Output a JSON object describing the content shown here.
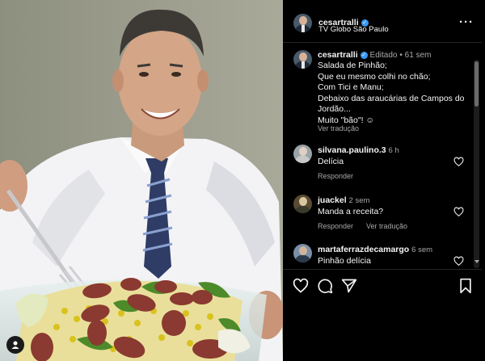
{
  "post": {
    "author": "cesartralli",
    "location": "TV Globo São Paulo",
    "more_icon": "more-horizontal-icon",
    "caption": {
      "author": "cesartralli",
      "edited": "Editado",
      "time": "61 sem",
      "lines": [
        "Salada de Pinhão;",
        "Que eu mesmo colhi no chão;",
        "Com Tici e Manu;",
        "Debaixo das araucárias de Campos do",
        "Jordão...",
        "Muito \"bão\"! ☺"
      ],
      "see_translation": "Ver tradução"
    },
    "comments": [
      {
        "user": "silvana.paulino.3",
        "time": "6 h",
        "text": "Delícia",
        "reply": "Responder",
        "translate": ""
      },
      {
        "user": "juackel",
        "time": "2 sem",
        "text": "Manda a receita?",
        "reply": "Responder",
        "translate": "Ver tradução"
      },
      {
        "user": "martaferrazdecamargo",
        "time": "6 sem",
        "text": "Pinhão delícia",
        "reply": "",
        "translate": ""
      }
    ]
  },
  "actions": {
    "like_icon": "heart-icon",
    "comment_icon": "comment-icon",
    "share_icon": "share-icon",
    "save_icon": "bookmark-icon"
  },
  "colors": {
    "accent": "#3897f0",
    "background": "#000000",
    "text": "#f5f5f5",
    "muted": "#a8a8a8"
  }
}
